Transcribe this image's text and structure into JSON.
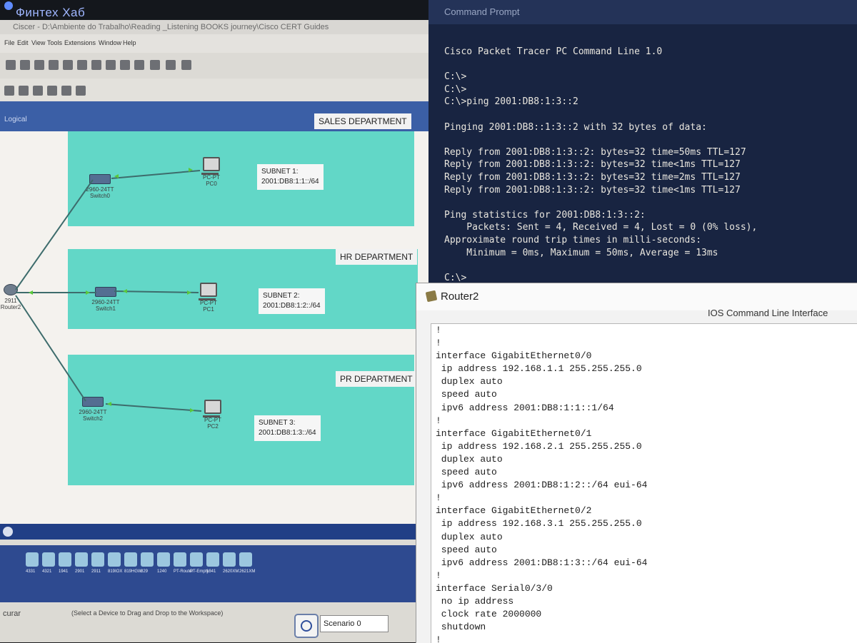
{
  "pt": {
    "logo": "Финтех Хаб",
    "path": "Ciscer - D:\\Ambiente do Trabalho\\Reading _Listening BOOKS journey\\Cisco CERT Guides",
    "menu": [
      "File",
      "Edit",
      "View",
      "Tools",
      "Extensions",
      "Window",
      "Help"
    ],
    "logical_label": "Logical",
    "departments": [
      {
        "label": "SALES DEPARTMENT",
        "subnet_title": "SUBNET 1:",
        "subnet_prefix": "2001:DB8:1:1::/64",
        "switch_model": "2960-24TT",
        "switch_name": "Switch0",
        "pc_model": "PC-PT",
        "pc_name": "PC0"
      },
      {
        "label": "HR DEPARTMENT",
        "subnet_title": "SUBNET 2:",
        "subnet_prefix": "2001:DB8:1:2::/64",
        "switch_model": "2960-24TT",
        "switch_name": "Switch1",
        "pc_model": "PC-PT",
        "pc_name": "PC1"
      },
      {
        "label": "PR DEPARTMENT",
        "subnet_title": "SUBNET 3:",
        "subnet_prefix": "2001:DB8:1:3::/64",
        "switch_model": "2960-24TT",
        "switch_name": "Switch2",
        "pc_model": "PC-PT",
        "pc_name": "PC2"
      }
    ],
    "router": {
      "model": "2911",
      "name": "Router2"
    },
    "status": {
      "left": "curar",
      "hint": "(Select a Device to Drag and Drop to the Workspace)",
      "scenario": "Scenario 0"
    },
    "device_strip": [
      "4331",
      "4321",
      "1941",
      "2901",
      "2911",
      "819IOX",
      "819HGW",
      "829",
      "1240",
      "PT-Router",
      "PT-Empty",
      "1841",
      "2620XM",
      "2621XM"
    ]
  },
  "cmd": {
    "title": "Command Prompt",
    "lines": [
      "Cisco Packet Tracer PC Command Line 1.0",
      "",
      "C:\\>",
      "C:\\>",
      "C:\\>ping 2001:DB8:1:3::2",
      "",
      "Pinging 2001:DB8::1:3::2 with 32 bytes of data:",
      "",
      "Reply from 2001:DB8:1:3::2: bytes=32 time=50ms TTL=127",
      "Reply from 2001:DB8:1:3::2: bytes=32 time<1ms TTL=127",
      "Reply from 2001:DB8:1:3::2: bytes=32 time=2ms TTL=127",
      "Reply from 2001:DB8:1:3::2: bytes=32 time<1ms TTL=127",
      "",
      "Ping statistics for 2001:DB8:1:3::2:",
      "    Packets: Sent = 4, Received = 4, Lost = 0 (0% loss),",
      "Approximate round trip times in milli-seconds:",
      "    Minimum = 0ms, Maximum = 50ms, Average = 13ms",
      "",
      "C:\\>"
    ]
  },
  "router2": {
    "title": "Router2",
    "header_right": "IOS Command Line Interface",
    "lines": [
      "!",
      "!",
      "interface GigabitEthernet0/0",
      " ip address 192.168.1.1 255.255.255.0",
      " duplex auto",
      " speed auto",
      " ipv6 address 2001:DB8:1:1::1/64",
      "!",
      "interface GigabitEthernet0/1",
      " ip address 192.168.2.1 255.255.255.0",
      " duplex auto",
      " speed auto",
      " ipv6 address 2001:DB8:1:2::/64 eui-64",
      "!",
      "interface GigabitEthernet0/2",
      " ip address 192.168.3.1 255.255.255.0",
      " duplex auto",
      " speed auto",
      " ipv6 address 2001:DB8:1:3::/64 eui-64",
      "!",
      "interface Serial0/3/0",
      " no ip address",
      " clock rate 2000000",
      " shutdown",
      "!"
    ]
  },
  "colors": {
    "dept_fill": "#62d7c7",
    "cmd_bg": "#182441",
    "logic_bar": "#3b5fa6",
    "link_line": "#3d6c6c",
    "link_dot": "#59c83b"
  }
}
